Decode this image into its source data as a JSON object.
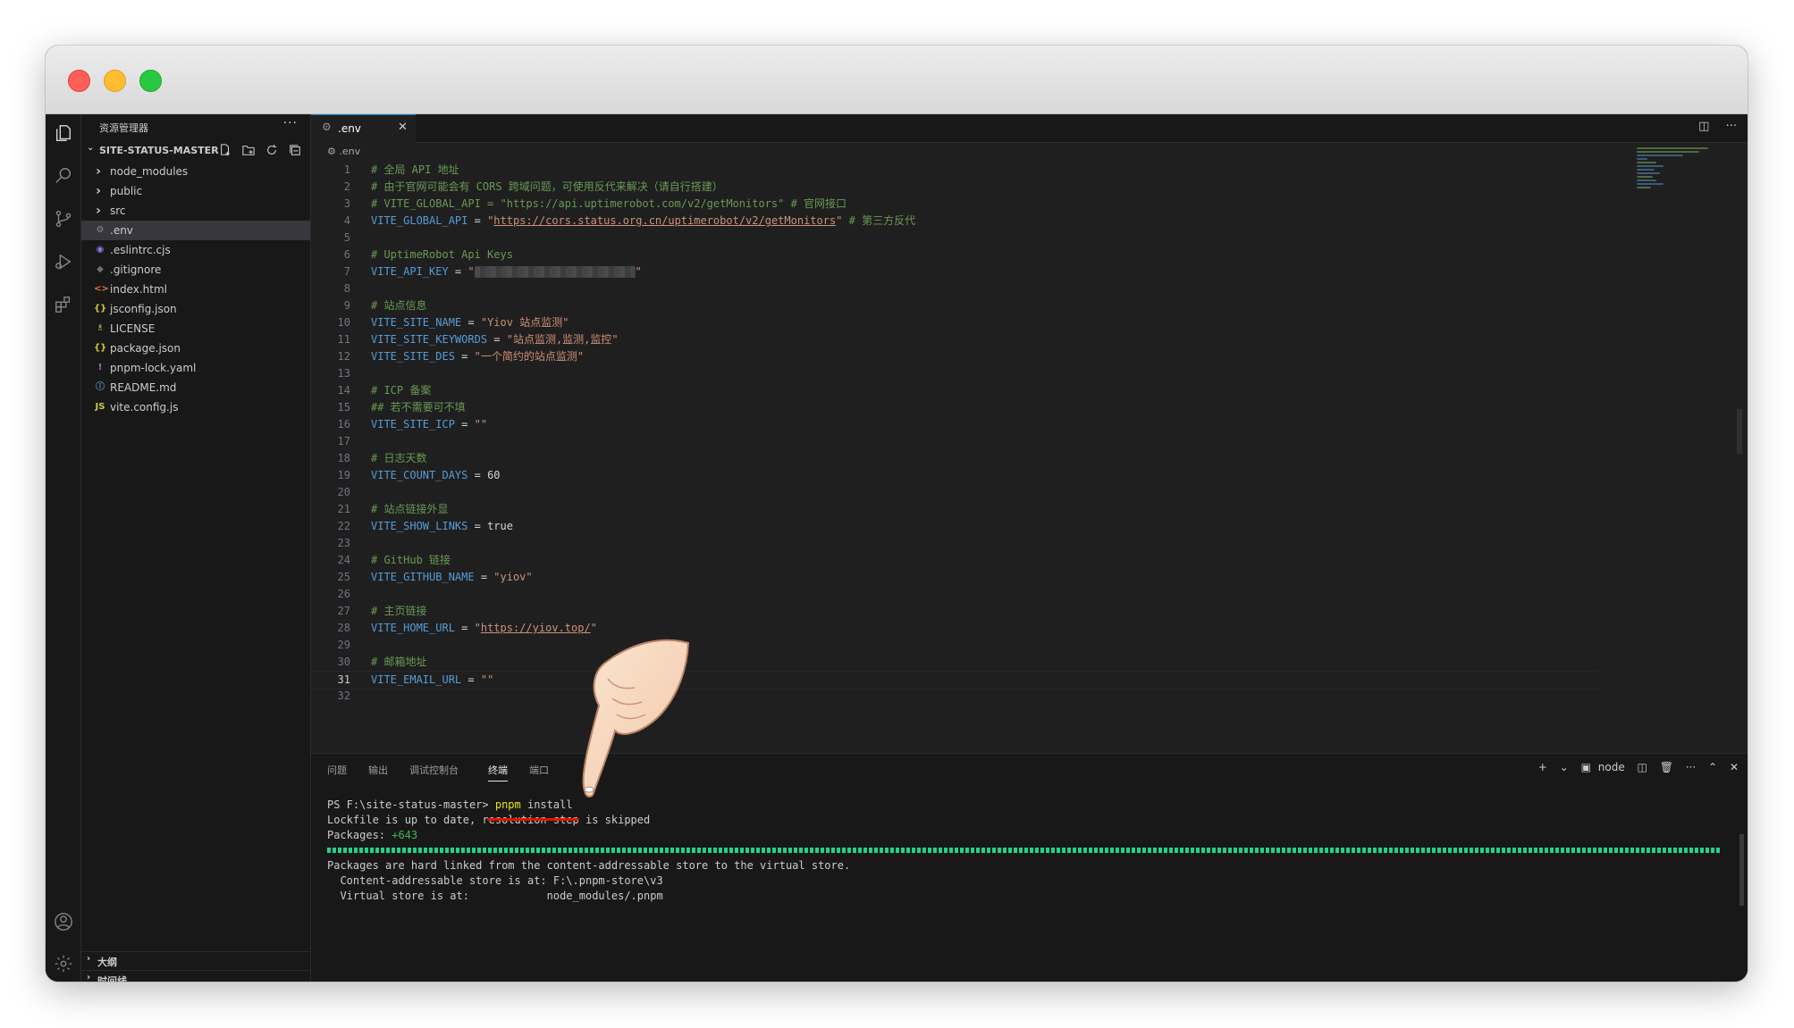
{
  "sidebar": {
    "title": "资源管理器",
    "more": "···",
    "project": "SITE-STATUS-MASTER",
    "items": [
      {
        "label": "node_modules",
        "icon": "chevron-right-icon",
        "glyph": "›"
      },
      {
        "label": "public",
        "icon": "chevron-right-icon",
        "glyph": "›"
      },
      {
        "label": "src",
        "icon": "chevron-right-icon",
        "glyph": "›"
      },
      {
        "label": ".env",
        "icon": "gear-icon",
        "glyph": "⚙"
      },
      {
        "label": ".eslintrc.cjs",
        "icon": "eslint-icon",
        "glyph": "◉"
      },
      {
        "label": ".gitignore",
        "icon": "git-icon",
        "glyph": "◆"
      },
      {
        "label": "index.html",
        "icon": "html-icon",
        "glyph": "<>"
      },
      {
        "label": "jsconfig.json",
        "icon": "json-icon",
        "glyph": "{}"
      },
      {
        "label": "LICENSE",
        "icon": "license-icon",
        "glyph": "♗"
      },
      {
        "label": "package.json",
        "icon": "json-icon",
        "glyph": "{}"
      },
      {
        "label": "pnpm-lock.yaml",
        "icon": "yaml-icon",
        "glyph": "!"
      },
      {
        "label": "README.md",
        "icon": "info-icon",
        "glyph": "ⓘ"
      },
      {
        "label": "vite.config.js",
        "icon": "js-icon",
        "glyph": "JS"
      }
    ],
    "outline_label": "大纲",
    "timeline_label": "时间线"
  },
  "editor": {
    "tab_label": ".env",
    "tab_close": "✕",
    "breadcrumb": ".env",
    "lines": [
      {
        "n": "1",
        "parts": [
          {
            "t": "# 全局 API 地址",
            "c": "com"
          }
        ]
      },
      {
        "n": "2",
        "parts": [
          {
            "t": "# 由于官网可能会有 CORS 跨域问题，可使用反代来解决（请自行搭建）",
            "c": "com"
          }
        ]
      },
      {
        "n": "3",
        "parts": [
          {
            "t": "# VITE_GLOBAL_API = \"https://api.uptimerobot.com/v2/getMonitors\" # 官网接口",
            "c": "com"
          }
        ]
      },
      {
        "n": "4",
        "parts": [
          {
            "t": "VITE_GLOBAL_API",
            "c": "key"
          },
          {
            "t": " = ",
            "c": "op"
          },
          {
            "t": "\"",
            "c": "str"
          },
          {
            "t": "https://cors.status.org.cn/uptimerobot/v2/getMonitors",
            "c": "str u"
          },
          {
            "t": "\"",
            "c": "str"
          },
          {
            "t": " # 第三方反代",
            "c": "com"
          }
        ]
      },
      {
        "n": "5",
        "parts": []
      },
      {
        "n": "6",
        "parts": [
          {
            "t": "# UptimeRobot Api Keys",
            "c": "com"
          }
        ]
      },
      {
        "n": "7",
        "parts": [
          {
            "t": "VITE_API_KEY",
            "c": "key"
          },
          {
            "t": " = ",
            "c": "op"
          },
          {
            "t": "\"",
            "c": "str"
          },
          {
            "t": "",
            "c": "mask"
          },
          {
            "t": "\"",
            "c": "str"
          }
        ]
      },
      {
        "n": "8",
        "parts": []
      },
      {
        "n": "9",
        "parts": [
          {
            "t": "# 站点信息",
            "c": "com"
          }
        ]
      },
      {
        "n": "10",
        "parts": [
          {
            "t": "VITE_SITE_NAME",
            "c": "key"
          },
          {
            "t": " = ",
            "c": "op"
          },
          {
            "t": "\"Yiov 站点监测\"",
            "c": "str"
          }
        ]
      },
      {
        "n": "11",
        "parts": [
          {
            "t": "VITE_SITE_KEYWORDS",
            "c": "key"
          },
          {
            "t": " = ",
            "c": "op"
          },
          {
            "t": "\"站点监测,监测,监控\"",
            "c": "str"
          }
        ]
      },
      {
        "n": "12",
        "parts": [
          {
            "t": "VITE_SITE_DES",
            "c": "key"
          },
          {
            "t": " = ",
            "c": "op"
          },
          {
            "t": "\"一个简约的站点监测\"",
            "c": "str"
          }
        ]
      },
      {
        "n": "13",
        "parts": []
      },
      {
        "n": "14",
        "parts": [
          {
            "t": "# ICP 备案",
            "c": "com"
          }
        ]
      },
      {
        "n": "15",
        "parts": [
          {
            "t": "## 若不需要可不填",
            "c": "com"
          }
        ]
      },
      {
        "n": "16",
        "parts": [
          {
            "t": "VITE_SITE_ICP",
            "c": "key"
          },
          {
            "t": " = ",
            "c": "op"
          },
          {
            "t": "\"\"",
            "c": "str"
          }
        ]
      },
      {
        "n": "17",
        "parts": []
      },
      {
        "n": "18",
        "parts": [
          {
            "t": "# 日志天数",
            "c": "com"
          }
        ]
      },
      {
        "n": "19",
        "parts": [
          {
            "t": "VITE_COUNT_DAYS",
            "c": "key"
          },
          {
            "t": " = ",
            "c": "op"
          },
          {
            "t": "60",
            "c": "op"
          }
        ]
      },
      {
        "n": "20",
        "parts": []
      },
      {
        "n": "21",
        "parts": [
          {
            "t": "# 站点链接外显",
            "c": "com"
          }
        ]
      },
      {
        "n": "22",
        "parts": [
          {
            "t": "VITE_SHOW_LINKS",
            "c": "key"
          },
          {
            "t": " = ",
            "c": "op"
          },
          {
            "t": "true",
            "c": "op"
          }
        ]
      },
      {
        "n": "23",
        "parts": []
      },
      {
        "n": "24",
        "parts": [
          {
            "t": "# GitHub 链接",
            "c": "com"
          }
        ]
      },
      {
        "n": "25",
        "parts": [
          {
            "t": "VITE_GITHUB_NAME",
            "c": "key"
          },
          {
            "t": " = ",
            "c": "op"
          },
          {
            "t": "\"yiov\"",
            "c": "str"
          }
        ]
      },
      {
        "n": "26",
        "parts": []
      },
      {
        "n": "27",
        "parts": [
          {
            "t": "# 主页链接",
            "c": "com"
          }
        ]
      },
      {
        "n": "28",
        "parts": [
          {
            "t": "VITE_HOME_URL",
            "c": "key"
          },
          {
            "t": " = ",
            "c": "op"
          },
          {
            "t": "\"",
            "c": "str"
          },
          {
            "t": "https://yiov.top/",
            "c": "str u"
          },
          {
            "t": "\"",
            "c": "str"
          }
        ]
      },
      {
        "n": "29",
        "parts": []
      },
      {
        "n": "30",
        "parts": [
          {
            "t": "# 邮箱地址",
            "c": "com"
          }
        ]
      },
      {
        "n": "31",
        "parts": [
          {
            "t": "VITE_EMAIL_URL",
            "c": "key"
          },
          {
            "t": " = ",
            "c": "op"
          },
          {
            "t": "\"\"",
            "c": "str"
          }
        ]
      },
      {
        "n": "32",
        "parts": []
      }
    ],
    "current_line": "31"
  },
  "panel": {
    "tabs": [
      "问题",
      "输出",
      "调试控制台",
      "终端",
      "端口"
    ],
    "active_tab": "终端",
    "shell_label": "node",
    "add": "+",
    "terminal": [
      {
        "parts": [
          {
            "t": "PS F:\\site-status-master> ",
            "c": ""
          },
          {
            "t": "pnpm",
            "c": "yellow"
          },
          {
            "t": " install",
            "c": ""
          }
        ]
      },
      {
        "parts": [
          {
            "t": "Lockfile is up to date, resolution step is skipped",
            "c": ""
          }
        ]
      },
      {
        "parts": [
          {
            "t": "Packages: ",
            "c": ""
          },
          {
            "t": "+643",
            "c": "green"
          }
        ]
      },
      {
        "parts": [
          {
            "t": "",
            "c": "progress"
          }
        ]
      },
      {
        "parts": [
          {
            "t": "Packages are hard linked from the content-addressable store to the virtual store.",
            "c": ""
          }
        ]
      },
      {
        "parts": [
          {
            "t": "  Content-addressable store is at: F:\\.pnpm-store\\v3",
            "c": ""
          }
        ]
      },
      {
        "parts": [
          {
            "t": "  Virtual store is at:            node_modules/.pnpm",
            "c": ""
          }
        ]
      }
    ]
  },
  "colors": {
    "accent": "#0078d4",
    "comment": "#6a9955",
    "keyword": "#569cd6",
    "string": "#ce9178",
    "annotation_red": "#e51400"
  }
}
